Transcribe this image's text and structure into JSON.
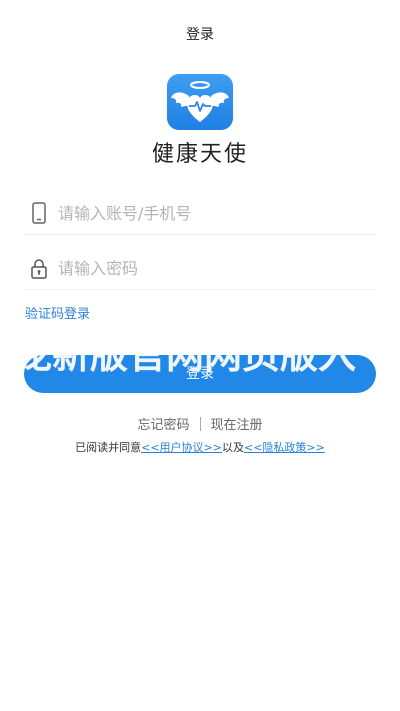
{
  "header": {
    "title": "登录"
  },
  "app": {
    "name": "健康天使",
    "logo_icon": "angel-heart-icon",
    "brand_color": "#2288e8"
  },
  "form": {
    "phone_icon": "phone-icon",
    "phone_placeholder": "请输入账号/手机号",
    "phone_value": "",
    "password_icon": "lock-icon",
    "password_placeholder": "请输入密码",
    "password_value": ""
  },
  "sms_login_label": "验证码登录",
  "login_button_label": "登录",
  "watermark_text": "龙新版官网网页版入",
  "links": {
    "forgot_password": "忘记密码",
    "register": "现在注册"
  },
  "agreement": {
    "prefix": "已阅读并同意",
    "user_agreement": "<<用户协议>>",
    "middle": "以及",
    "privacy_policy": "<<隐私政策>>"
  },
  "colors": {
    "link": "#2a82d6",
    "placeholder": "#b4b4b4"
  }
}
